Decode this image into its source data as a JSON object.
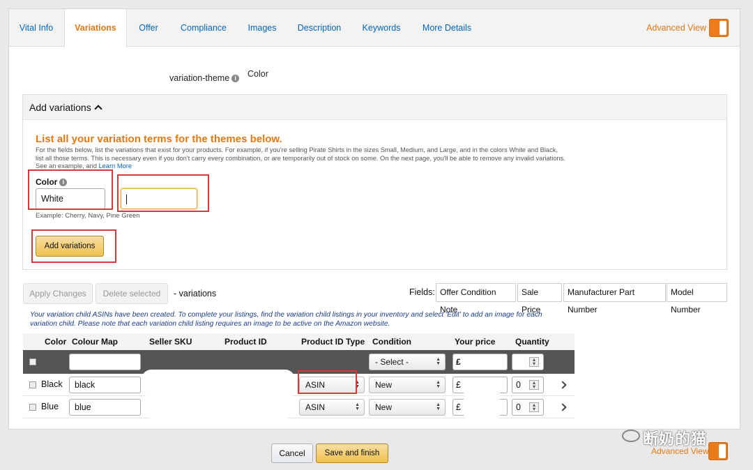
{
  "tabs": [
    {
      "label": "Vital Info"
    },
    {
      "label": "Variations"
    },
    {
      "label": "Offer"
    },
    {
      "label": "Compliance"
    },
    {
      "label": "Images"
    },
    {
      "label": "Description"
    },
    {
      "label": "Keywords"
    },
    {
      "label": "More Details"
    }
  ],
  "active_tab": "Variations",
  "advanced_view_label": "Advanced View",
  "variation_theme": {
    "label": "variation-theme",
    "value": "Color"
  },
  "add_variations": {
    "header": "Add variations",
    "title": "List all your variation terms for the themes below.",
    "description": "For the fields below, list the variations that exist for your products. For example, if you're selling Pirate Shirts in the sizes Small, Medium, and Large, and in the colors White and Black, list all those terms. This is necessary even if you don't carry every combination, or are temporarily out of stock on some. On the next page, you'll be able to remove any invalid variations. See an example, and",
    "learn_more": "Learn More",
    "color_label": "Color",
    "color_value_1": "White",
    "color_value_2": "",
    "example": "Example:  Cherry, Navy, Pine Green",
    "button": "Add variations"
  },
  "toolbar": {
    "apply_changes": "Apply Changes",
    "delete_selected": "Delete selected",
    "variations_suffix": "- variations",
    "fields_label": "Fields:",
    "field_buttons": [
      "Offer Condition Note",
      "Sale Price",
      "Manufacturer Part Number",
      "Model Number"
    ]
  },
  "notice": "Your variation child ASINs have been created. To complete your listings, find the variation child listings in your inventory and select 'Edit' to add an image for each variation child. Please note that each variation child listing requires an image to be active on the Amazon website.",
  "table": {
    "headers": [
      "Color",
      "Colour Map",
      "Seller SKU",
      "Product ID",
      "Product ID Type",
      "Condition",
      "Your price",
      "Quantity"
    ],
    "bulk_row": {
      "condition": "- Select -",
      "currency": "£"
    },
    "rows": [
      {
        "color": "Black",
        "colour_map": "black",
        "product_id_type": "ASIN",
        "condition": "New",
        "currency": "£",
        "quantity": "0"
      },
      {
        "color": "Blue",
        "colour_map": "blue",
        "product_id_type": "ASIN",
        "condition": "New",
        "currency": "£",
        "quantity": "0"
      }
    ]
  },
  "footer": {
    "cancel": "Cancel",
    "save": "Save and finish"
  },
  "watermark": "断奶的猫",
  "colors": {
    "accent_orange": "#e47911",
    "link_blue": "#0066c0",
    "highlight_red": "#d9383a",
    "button_yellow": "#f0c14b"
  }
}
